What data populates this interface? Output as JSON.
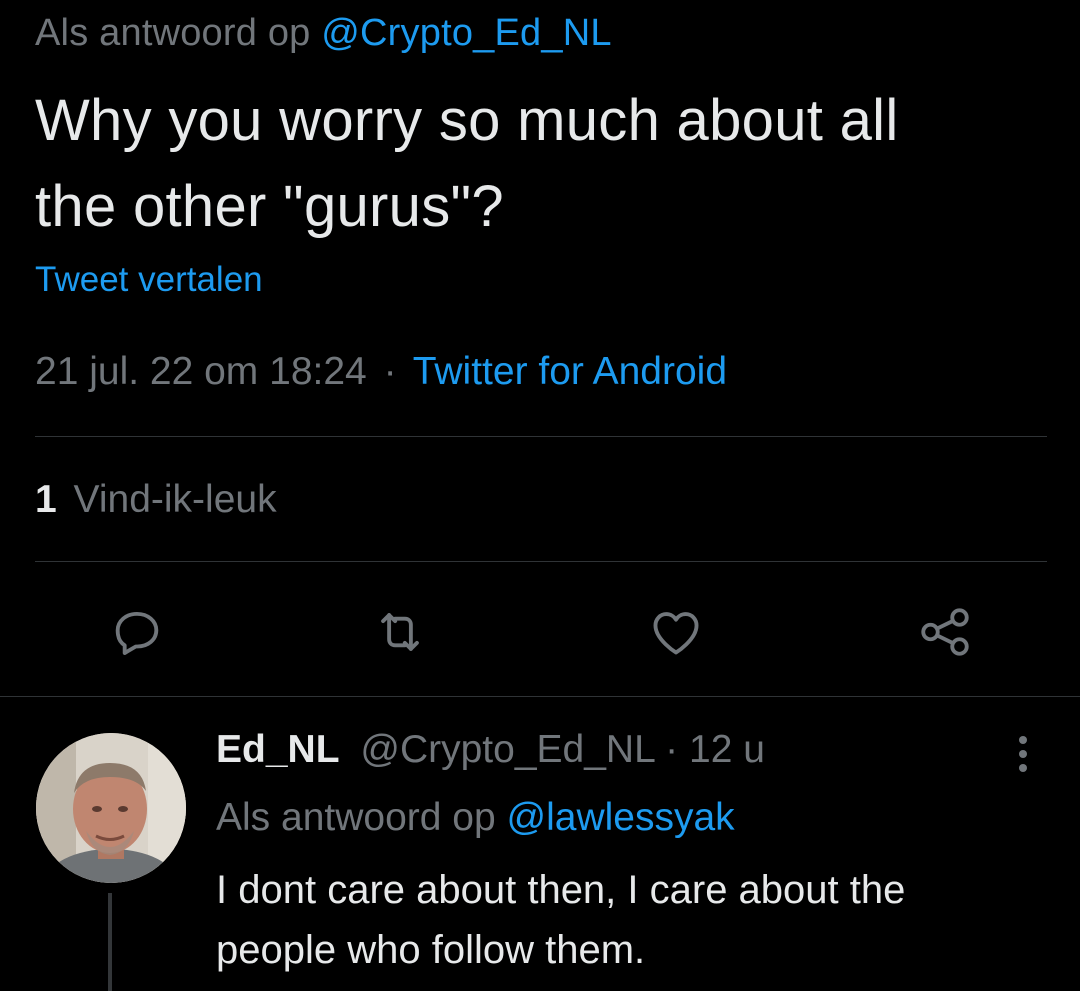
{
  "tweet": {
    "reply_prefix": "Als antwoord op",
    "reply_handle": "@Crypto_Ed_NL",
    "text_line1": "Why you worry so much about all",
    "text_line2": "the other \"gurus\"?",
    "translate_label": "Tweet vertalen",
    "timestamp": "21 jul. 22 om 18:24",
    "separator": "·",
    "source": "Twitter for Android",
    "like_count": "1",
    "like_label": "Vind-ik-leuk"
  },
  "actions": {
    "icons": [
      "reply-icon",
      "retweet-icon",
      "like-icon",
      "share-icon"
    ]
  },
  "reply": {
    "name": "Ed_NL",
    "handle": "@Crypto_Ed_NL",
    "separator": "·",
    "time": "12 u",
    "reply_prefix": "Als antwoord op",
    "reply_handle": "@lawlessyak",
    "text_line1": "I dont care about then, I care about the",
    "text_line2": "people who follow them."
  },
  "colors": {
    "background": "#000000",
    "text": "#e7e9ea",
    "secondary": "#71767b",
    "link": "#1d9bf0",
    "divider": "#2f3336"
  }
}
